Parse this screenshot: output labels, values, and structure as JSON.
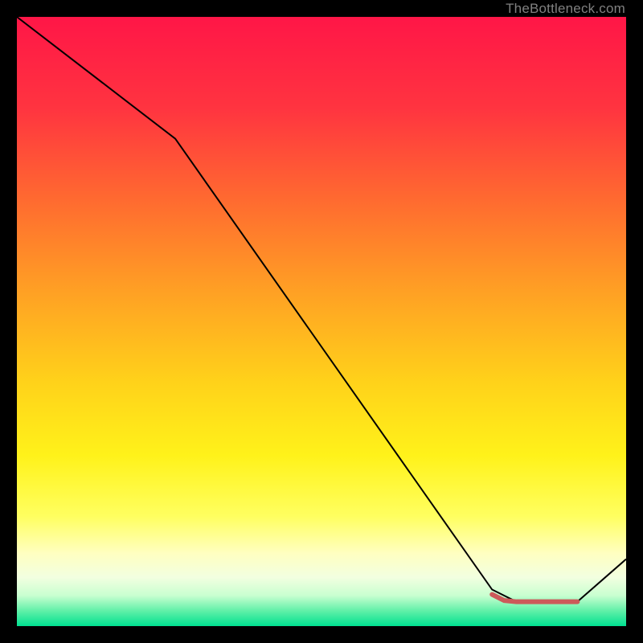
{
  "attribution": "TheBottleneck.com",
  "chart_data": {
    "type": "line",
    "title": "",
    "xlabel": "",
    "ylabel": "",
    "xlim": [
      0,
      100
    ],
    "ylim": [
      0,
      100
    ],
    "gradient_stops": [
      {
        "offset": 0.0,
        "color": "#ff1647"
      },
      {
        "offset": 0.15,
        "color": "#ff3440"
      },
      {
        "offset": 0.3,
        "color": "#ff6a30"
      },
      {
        "offset": 0.45,
        "color": "#ffa024"
      },
      {
        "offset": 0.6,
        "color": "#ffd21a"
      },
      {
        "offset": 0.72,
        "color": "#fff21a"
      },
      {
        "offset": 0.82,
        "color": "#ffff60"
      },
      {
        "offset": 0.88,
        "color": "#ffffc0"
      },
      {
        "offset": 0.92,
        "color": "#f2ffe0"
      },
      {
        "offset": 0.95,
        "color": "#c8ffd0"
      },
      {
        "offset": 0.975,
        "color": "#60f0a8"
      },
      {
        "offset": 1.0,
        "color": "#00e090"
      }
    ],
    "series": [
      {
        "name": "bottleneck-curve",
        "stroke": "#000000",
        "stroke_width": 2,
        "x": [
          0,
          26,
          78,
          82,
          92,
          100
        ],
        "y": [
          100,
          80,
          6,
          4,
          4,
          11
        ]
      },
      {
        "name": "optimal-marker",
        "stroke": "#cc5a5a",
        "stroke_width": 6,
        "linecap": "round",
        "x": [
          78,
          80,
          82,
          92
        ],
        "y": [
          5.2,
          4.2,
          4.0,
          4.0
        ]
      }
    ]
  }
}
